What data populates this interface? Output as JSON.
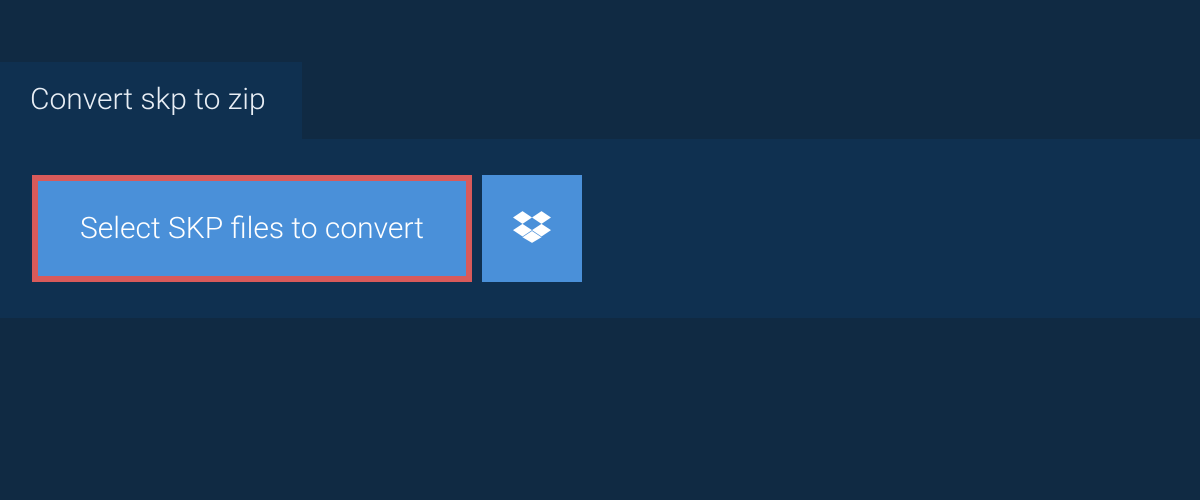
{
  "tab": {
    "label": "Convert skp to zip"
  },
  "buttons": {
    "select_files_label": "Select SKP files to convert"
  },
  "colors": {
    "background": "#102a43",
    "panel": "#0f3050",
    "button_primary": "#4a90d9",
    "highlight_border": "#d85a5a"
  }
}
